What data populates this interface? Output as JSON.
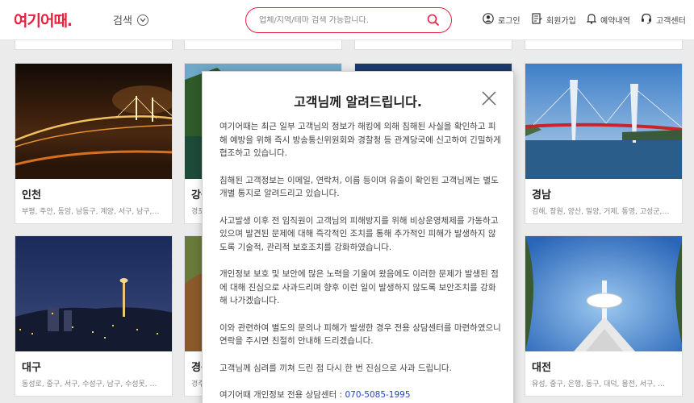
{
  "header": {
    "logo": "여기어때.",
    "search_toggle_label": "검색",
    "search_placeholder": "업체/지역/테마 검색 가능합니다.",
    "nav": {
      "login": "로그인",
      "signup": "회원가입",
      "reservations": "예약내역",
      "support": "고객센터"
    }
  },
  "cards": [
    {
      "title": "인천",
      "subtitle": "부평, 주안, 동암, 남동구, 계양, 서구, 남구, 동구,"
    },
    {
      "title": "강원",
      "subtitle": "경포"
    },
    {
      "title": "경남",
      "subtitle": "김해, 창원, 양산, 밀양, 거제, 통영, 고성군, 진주"
    },
    {
      "title": "대구",
      "subtitle": "동성로, 중구, 서구, 수성구, 남구, 수성못, 동대…"
    },
    {
      "title": "경북",
      "subtitle": "경주"
    },
    {
      "title": "대전",
      "subtitle": "유성, 중구, 은행, 동구, 대덕, 용전, 서구, 둔산,…"
    }
  ],
  "modal": {
    "title": "고객님께 알려드립니다.",
    "paragraphs": [
      "여기어때는 최근 일부 고객님의 정보가 해킹에 의해 침해된 사실을 확인하고 피해 예방을 위해 즉시 방송통신위원회와 경찰청 등 관계당국에 신고하여 긴밀하게 협조하고 있습니다.",
      "침해된 고객정보는 이메일, 연락처, 이름 등이며 유출이 확인된 고객님께는 별도 개별 통지로 알려드리고 있습니다.",
      "사고발생 이후 전 임직원이 고객님의 피해방지를 위해 비상운영체제를 가동하고 있으며 발견된 문제에 대해 즉각적인 조치를 통해 추가적인 피해가 발생하지 않도록 기술적, 관리적 보호조치를 강화하였습니다.",
      "개인정보 보호 및 보안에 많은 노력을 기울여 왔음에도 이러한 문제가 발생된 점에 대해 진심으로 사과드리며 향후 이런 일이 발생하지 않도록 보안조치를 강화해 나가겠습니다.",
      "이와 관련하여 별도의 문의나 피해가 발생한 경우 전용 상담센터를 마련하였으니 연락을 주시면 친절히 안내해 드리겠습니다.",
      "고객님께 심려를 끼쳐 드린 점 다시 한 번 진심으로 사과 드립니다."
    ],
    "contact_label": "여기어때 개인정보 전용 상담센터 : ",
    "contact_phone": "070-5085-1995"
  },
  "colors": {
    "brand": "#e8203f",
    "phone_link": "#2446b5"
  },
  "icons": [
    "chevron-down-icon",
    "search-icon",
    "user-icon",
    "document-icon",
    "bell-icon",
    "headset-icon",
    "close-icon"
  ]
}
